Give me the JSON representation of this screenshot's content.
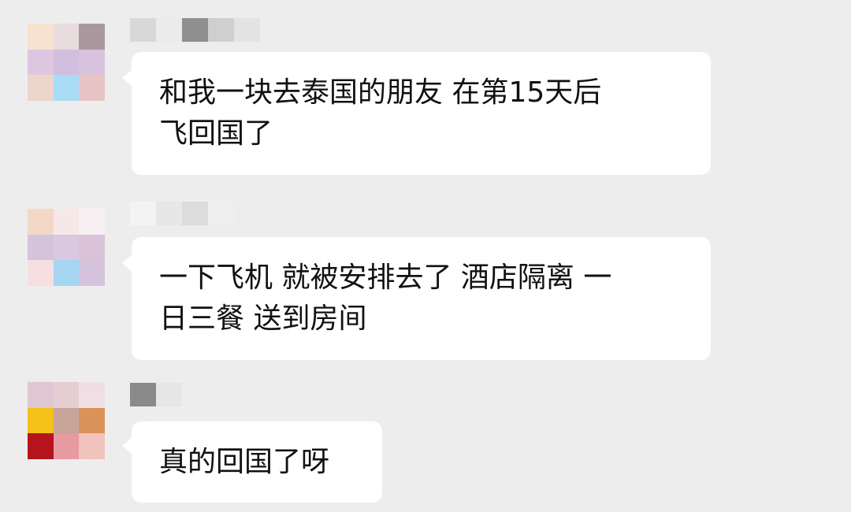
{
  "messages": [
    {
      "text": "和我一块去泰国的朋友 在第15天后\n飞回国了",
      "avatar_colors": [
        "#f6e2cf",
        "#e8dcdf",
        "#a9989d",
        "#dcc6e0",
        "#d2bfe0",
        "#d7c3dd",
        "#ecd6cb",
        "#a9dcf5",
        "#e8c3c4"
      ],
      "nickname_colors": [
        "#d8d8d8",
        "#ebebeb",
        "#8f8f8f",
        "#cfcfcf",
        "#e3e3e3"
      ]
    },
    {
      "text": "一下飞机 就被安排去了 酒店隔离 一\n日三餐 送到房间",
      "avatar_colors": [
        "#f3d8c7",
        "#f6e8e6",
        "#f6f0f3",
        "#d4c3db",
        "#d9c8df",
        "#dac2d9",
        "#f6dfe1",
        "#a6d7f2",
        "#d5c2dd"
      ],
      "nickname_colors": [
        "#f3f3f3",
        "#e7e7e7",
        "#dcdcdc",
        "#efefef"
      ]
    },
    {
      "text": "真的回国了呀",
      "avatar_colors": [
        "#e0c6d3",
        "#e5cdd4",
        "#efdfe4",
        "#f5c21a",
        "#c7a59a",
        "#da9258",
        "#b5141d",
        "#e79ba1",
        "#f0c3bc"
      ],
      "nickname_colors": [
        "#8a8a8a",
        "#e6e6e6"
      ]
    }
  ]
}
